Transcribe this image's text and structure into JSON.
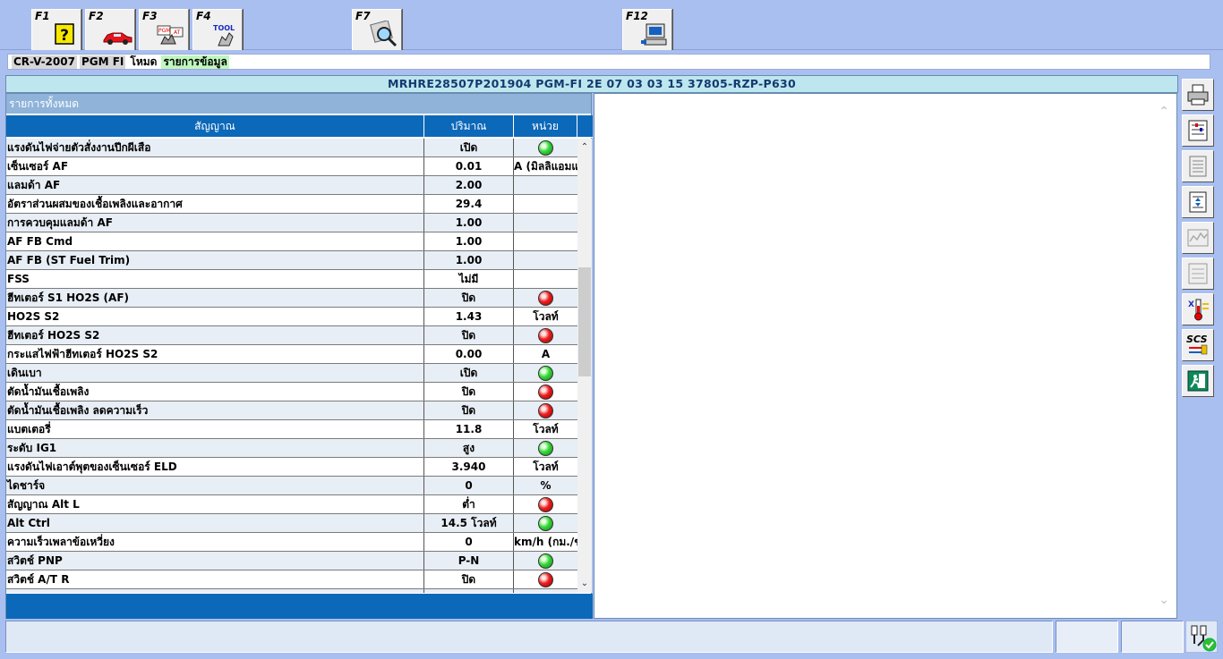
{
  "toolbar": {
    "keys": [
      {
        "label": "F1",
        "icon": "help-icon"
      },
      {
        "label": "F2",
        "icon": "car-icon"
      },
      {
        "label": "F3",
        "icon": "pgm-at-icon",
        "icon_text": "PGM AT"
      },
      {
        "label": "F4",
        "icon": "tool-icon",
        "icon_text": "TOOL"
      },
      {
        "label": "F7",
        "icon": "magnifier-icon"
      },
      {
        "label": "F12",
        "icon": "computer-icon"
      }
    ]
  },
  "breadcrumb": {
    "model": "CR-V-2007",
    "system": "PGM FI",
    "mode": "โหมด",
    "list": "รายการข้อมูล"
  },
  "infobar": "MRHRE28507P201904  PGM-FI  2E 07 03 03 15  37805-RZP-P630",
  "left_panel": {
    "title": "รายการทั้งหมด",
    "columns": [
      "สัญญาณ",
      "ปริมาณ",
      "หน่วย"
    ]
  },
  "rows": [
    {
      "signal": "แรงดันไฟจ่ายตัวสั่งงานปีกผีเสือ",
      "value": "เปิด",
      "unit": "",
      "led": "green"
    },
    {
      "signal": "เซ็นเซอร์ AF",
      "value": "0.01",
      "unit": "A (มิลลิแอมแปร์)",
      "led": ""
    },
    {
      "signal": "แลมด้า AF",
      "value": "2.00",
      "unit": "",
      "led": ""
    },
    {
      "signal": "อัตราส่วนผสมของเชื้อเพลิงและอากาศ",
      "value": "29.4",
      "unit": "",
      "led": ""
    },
    {
      "signal": "การควบคุมแลมด้า AF",
      "value": "1.00",
      "unit": "",
      "led": ""
    },
    {
      "signal": "AF FB Cmd",
      "value": "1.00",
      "unit": "",
      "led": ""
    },
    {
      "signal": "AF FB (ST Fuel Trim)",
      "value": "1.00",
      "unit": "",
      "led": ""
    },
    {
      "signal": "FSS",
      "value": "ไม่มี",
      "unit": "",
      "led": ""
    },
    {
      "signal": "ฮีทเตอร์ S1 HO2S (AF)",
      "value": "ปิด",
      "unit": "",
      "led": "red"
    },
    {
      "signal": "HO2S S2",
      "value": "1.43",
      "unit": "โวลท์",
      "led": ""
    },
    {
      "signal": "ฮีทเตอร์ HO2S S2",
      "value": "ปิด",
      "unit": "",
      "led": "red"
    },
    {
      "signal": "กระแสไฟฟ้าฮีทเตอร์ HO2S S2",
      "value": "0.00",
      "unit": "A",
      "led": ""
    },
    {
      "signal": "เดินเบา",
      "value": "เปิด",
      "unit": "",
      "led": "green"
    },
    {
      "signal": "ตัดน้ำมันเชื้อเพลิง",
      "value": "ปิด",
      "unit": "",
      "led": "red"
    },
    {
      "signal": "ตัดน้ำมันเชื้อเพลิง ลดความเร็ว",
      "value": "ปิด",
      "unit": "",
      "led": "red"
    },
    {
      "signal": "แบตเตอรี่",
      "value": "11.8",
      "unit": "โวลท์",
      "led": ""
    },
    {
      "signal": "ระดับ IG1",
      "value": "สูง",
      "unit": "",
      "led": "green"
    },
    {
      "signal": "แรงดันไฟเอาต์พุตของเซ็นเซอร์ ELD",
      "value": "3.940",
      "unit": "โวลท์",
      "led": ""
    },
    {
      "signal": "ไดชาร์จ",
      "value": "0",
      "unit": "%",
      "led": ""
    },
    {
      "signal": "สัญญาณ Alt L",
      "value": "ต่ำ",
      "unit": "",
      "led": "red"
    },
    {
      "signal": "Alt Ctrl",
      "value": "14.5 โวลท์",
      "unit": "",
      "led": "green"
    },
    {
      "signal": "ความเร็วเพลาข้อเหวี่ยง",
      "value": "0",
      "unit": "km/h (กม./ชม.)",
      "led": ""
    },
    {
      "signal": "สวิตช์ PNP",
      "value": "P-N",
      "unit": "",
      "led": "green"
    },
    {
      "signal": "สวิตช์ A/T R",
      "value": "ปิด",
      "unit": "",
      "led": "red"
    },
    {
      "signal": "",
      "value": "",
      "unit": "",
      "led": ""
    }
  ],
  "side_tools": [
    "printer-icon",
    "settings-list-icon",
    "document-icon",
    "scroll-list-icon",
    "graph-icon",
    "grid-settings-icon",
    "temperature-icon",
    "scs-icon",
    "exit-icon"
  ],
  "side_tool_texts": {
    "scs": "SCS"
  },
  "status": {
    "main": "",
    "seg2": "",
    "seg3": "",
    "icon": "connection-icon"
  },
  "colors": {
    "background": "#a9bff0",
    "header_blue": "#0c68b8",
    "info_bg": "#bde6ef",
    "led_green": "#37d83a",
    "led_red": "#ee1f1f"
  }
}
